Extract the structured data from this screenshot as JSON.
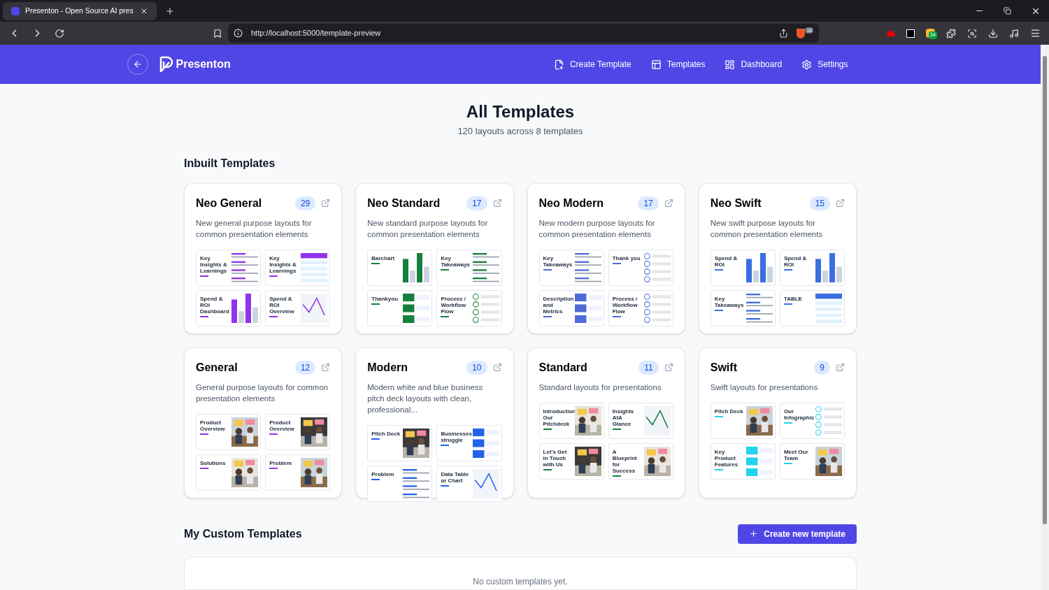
{
  "browser": {
    "tab": {
      "title": "Presenton - Open Source AI pres"
    },
    "url": "http://localhost:5000/template-preview",
    "shield_badge": "18",
    "extension_badge": "34"
  },
  "header": {
    "brand": "Presenton",
    "nav": [
      {
        "label": "Create Template",
        "kind": "create"
      },
      {
        "label": "Templates",
        "kind": "templates"
      },
      {
        "label": "Dashboard",
        "kind": "dashboard"
      },
      {
        "label": "Settings",
        "kind": "settings"
      }
    ]
  },
  "page": {
    "title": "All Templates",
    "subtitle": "120 layouts across 8 templates"
  },
  "inbuilt": {
    "heading": "Inbuilt Templates",
    "templates": [
      {
        "name": "Neo General",
        "count": "29",
        "description": "New general purpose layouts for common presentation elements",
        "color": "#9333ea",
        "slides": [
          {
            "title": "Key Insights & Learnings",
            "kind": "list"
          },
          {
            "title": "Key Insights & Learnings",
            "kind": "table"
          },
          {
            "title": "Spend & ROI Dashboard",
            "kind": "bars"
          },
          {
            "title": "Spend & ROI Overview",
            "kind": "line"
          }
        ]
      },
      {
        "name": "Neo Standard",
        "count": "17",
        "description": "New standard purpose layouts for common presentation elements",
        "color": "#15803d",
        "slides": [
          {
            "title": "Barchart",
            "kind": "bars"
          },
          {
            "title": "Key Takeaways",
            "kind": "list"
          },
          {
            "title": "Thankyou",
            "kind": "cards"
          },
          {
            "title": "Process / Workflow Flow",
            "kind": "steps"
          }
        ]
      },
      {
        "name": "Neo Modern",
        "count": "17",
        "description": "New modern purpose layouts for common presentation elements",
        "color": "#4f6bd8",
        "slides": [
          {
            "title": "Key Takeaways",
            "kind": "list"
          },
          {
            "title": "Thank you",
            "kind": "steps"
          },
          {
            "title": "Description and Metrics",
            "kind": "cards"
          },
          {
            "title": "Process / Workflow Flow",
            "kind": "steps"
          }
        ]
      },
      {
        "name": "Neo Swift",
        "count": "15",
        "description": "New swift purpose layouts for common presentation elements",
        "color": "#3b6fe0",
        "slides": [
          {
            "title": "Spend & ROI",
            "kind": "bars"
          },
          {
            "title": "Spend & ROI",
            "kind": "bars"
          },
          {
            "title": "Key Takeaways",
            "kind": "list"
          },
          {
            "title": "TABLE",
            "kind": "table"
          }
        ]
      },
      {
        "name": "General",
        "count": "12",
        "description": "General purpose layouts for common presentation elements",
        "color": "#9333ea",
        "slides": [
          {
            "title": "Product Overview"
          },
          {
            "title": "Product Overview"
          },
          {
            "title": "Solutions"
          },
          {
            "title": "Problem"
          }
        ]
      },
      {
        "name": "Modern",
        "count": "10",
        "description": "Modern white and blue business pitch deck layouts with clean, professional...",
        "color": "#2563eb",
        "slides": [
          {
            "title": "Pitch Deck"
          },
          {
            "title": "Businesses struggle",
            "kind": "cards"
          },
          {
            "title": "Problem",
            "kind": "list"
          },
          {
            "title": "Data Table or Chart",
            "kind": "line"
          }
        ]
      },
      {
        "name": "Standard",
        "count": "11",
        "description": "Standard layouts for presentations",
        "color": "#15803d",
        "slides": [
          {
            "title": "Introduction Our Pitchdeck"
          },
          {
            "title": "Insights AtA Glance",
            "kind": "line"
          },
          {
            "title": "Let's Get in Touch with Us"
          },
          {
            "title": "A Blueprint for Success"
          }
        ]
      },
      {
        "name": "Swift",
        "count": "9",
        "description": "Swift layouts for presentations",
        "color": "#22d3ee",
        "slides": [
          {
            "title": "Pitch Deck"
          },
          {
            "title": "Our Infographic",
            "kind": "steps"
          },
          {
            "title": "Key Product Features",
            "kind": "cards"
          },
          {
            "title": "Meet Our Team"
          }
        ]
      }
    ]
  },
  "custom": {
    "heading": "My Custom Templates",
    "button": "Create new template",
    "empty": "No custom templates yet."
  }
}
